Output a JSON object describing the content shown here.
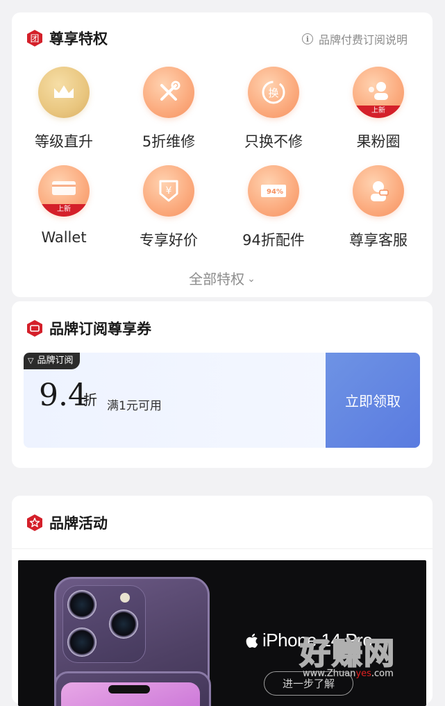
{
  "privileges": {
    "title": "尊享特权",
    "header_icon_char": "团",
    "explain_link": "品牌付费订阅说明",
    "items": [
      {
        "label": "等级直升",
        "icon": "crown-icon",
        "new": false
      },
      {
        "label": "5折维修",
        "icon": "repair-tools-icon",
        "new": false
      },
      {
        "label": "只换不修",
        "icon": "exchange-icon",
        "new": false
      },
      {
        "label": "果粉圈",
        "icon": "community-icon",
        "new": true
      },
      {
        "label": "Wallet",
        "icon": "wallet-card-icon",
        "new": true
      },
      {
        "label": "专享好价",
        "icon": "price-tag-icon",
        "new": false
      },
      {
        "label": "94折配件",
        "icon": "accessory-coupon-icon",
        "new": false
      },
      {
        "label": "尊享客服",
        "icon": "customer-service-icon",
        "new": false
      }
    ],
    "new_badge": "上新",
    "exchange_char": "换",
    "yen_char": "¥",
    "coupon_icon_text": "94%",
    "all_link": "全部特权",
    "all_chevron": "⌄"
  },
  "coupon_section": {
    "title": "品牌订阅尊享券",
    "coupon": {
      "tag": "品牌订阅",
      "tag_icon": "▽",
      "value": "9.4",
      "unit": "折",
      "condition": "满1元可用",
      "button": "立即领取"
    }
  },
  "activity_section": {
    "title": "品牌活动",
    "banner": {
      "product": "iPhone 14 Pro",
      "cta": "进一步了解"
    }
  },
  "watermark": {
    "brand": "好赚网",
    "url_prefix": "www.Zhuan",
    "url_highlight": "yes",
    "url_suffix": ".com"
  },
  "colors": {
    "accent_red": "#d4202a",
    "icon_orange": "#f59160",
    "icon_gold": "#d9ae62",
    "button_blue": "#5a7be0"
  }
}
